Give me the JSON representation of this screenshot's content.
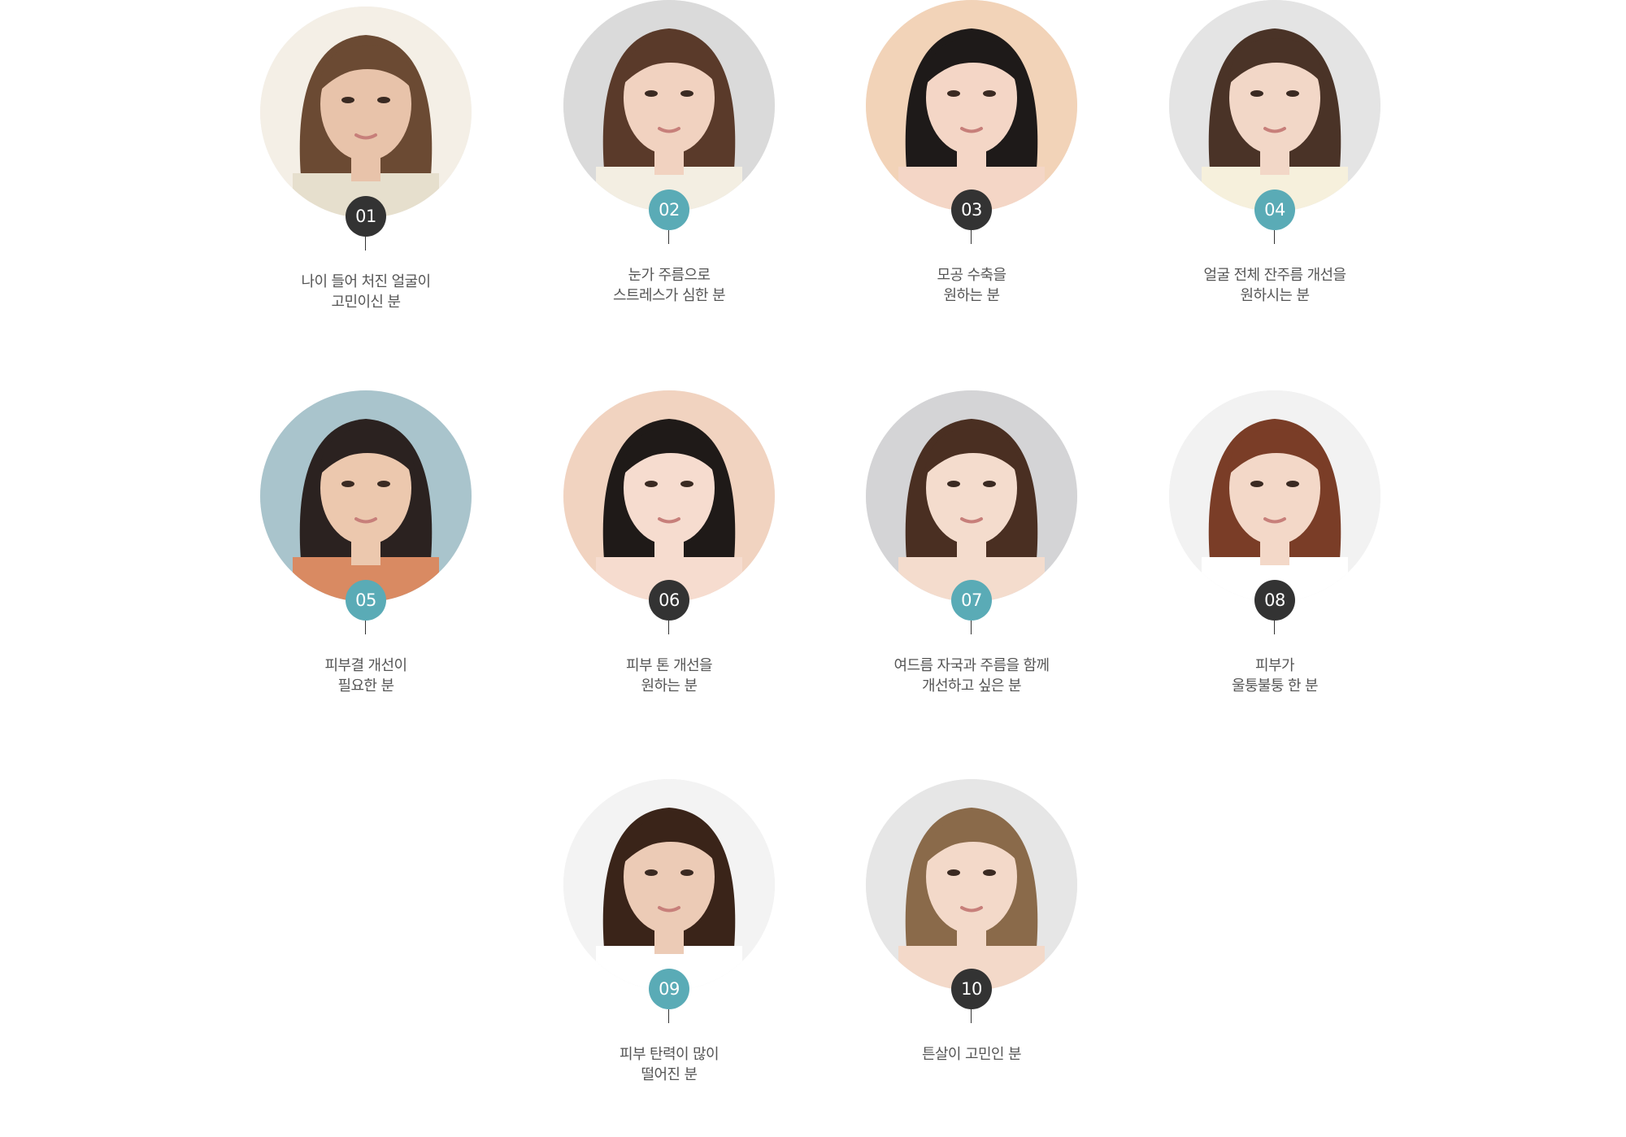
{
  "colors": {
    "badge_dark": "#333333",
    "badge_teal": "#5aabb6",
    "label_text": "#555555",
    "background": "#ffffff"
  },
  "items": [
    {
      "number": "01",
      "badge": "dark",
      "line1": "나이 들어 처진 얼굴이",
      "line2": "고민이신 분",
      "hair": "#6b4a33",
      "skin": "#e8c3aa",
      "bg": "#f4efe6",
      "top": "#e6dfcd"
    },
    {
      "number": "02",
      "badge": "teal",
      "line1": "눈가 주름으로",
      "line2": "스트레스가 심한 분",
      "hair": "#5a3a2a",
      "skin": "#f1d2c0",
      "bg": "#dadada",
      "top": "#f3eee2"
    },
    {
      "number": "03",
      "badge": "dark",
      "line1": "모공 수축을",
      "line2": "원하는 분",
      "hair": "#1e1a19",
      "skin": "#f4d6c6",
      "bg": "#f2d3b8",
      "top": "#f4d6c6"
    },
    {
      "number": "04",
      "badge": "teal",
      "line1": "얼굴 전체 잔주름 개선을",
      "line2": "원하시는 분",
      "hair": "#4a3327",
      "skin": "#f2d7c7",
      "bg": "#e4e4e4",
      "top": "#f6f0dc"
    },
    {
      "number": "05",
      "badge": "teal",
      "line1": "피부결 개선이",
      "line2": "필요한 분",
      "hair": "#2b2220",
      "skin": "#ecc8ae",
      "bg": "#a9c4cc",
      "top": "#d98a62"
    },
    {
      "number": "06",
      "badge": "dark",
      "line1": "피부 톤 개선을",
      "line2": "원하는 분",
      "hair": "#1f1a18",
      "skin": "#f6dccf",
      "bg": "#f1d3c0",
      "top": "#f6dccf"
    },
    {
      "number": "07",
      "badge": "teal",
      "line1": "여드름 자국과 주름을 함께",
      "line2": "개선하고 싶은 분",
      "hair": "#4a2f22",
      "skin": "#f4dccd",
      "bg": "#d4d4d6",
      "top": "#f4dccd"
    },
    {
      "number": "08",
      "badge": "dark",
      "line1": "피부가",
      "line2": "울퉁불퉁 한 분",
      "hair": "#7a3d27",
      "skin": "#f3d8c8",
      "bg": "#f2f2f2",
      "top": "#ffffff"
    },
    {
      "number": "09",
      "badge": "teal",
      "line1": "피부 탄력이 많이",
      "line2": "떨어진 분",
      "hair": "#3a2419",
      "skin": "#eccbb6",
      "bg": "#f3f3f3",
      "top": "#ffffff"
    },
    {
      "number": "10",
      "badge": "dark",
      "line1": "튼살이 고민인 분",
      "line2": "",
      "hair": "#8a6a4a",
      "skin": "#f3d9c9",
      "bg": "#e6e6e6",
      "top": "#f3d9c9"
    }
  ]
}
